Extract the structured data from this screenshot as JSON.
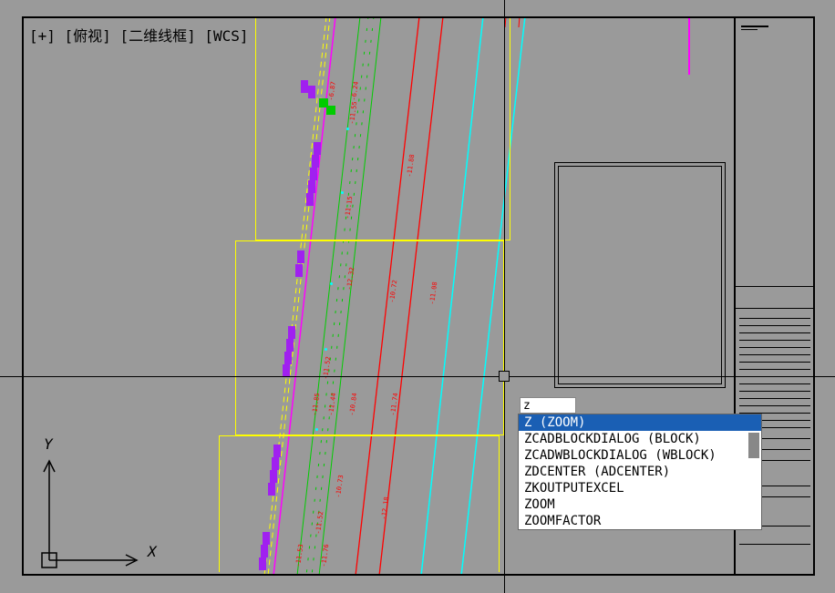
{
  "view_controls": {
    "toggle": "[+]",
    "view": "[俯视]",
    "style": "[二维线框]",
    "cs": "[WCS]"
  },
  "ucs": {
    "x_label": "X",
    "y_label": "Y"
  },
  "command": {
    "input_value": "z",
    "suggestions": [
      {
        "label": "Z (ZOOM)",
        "selected": true
      },
      {
        "label": "ZCADBLOCKDIALOG (BLOCK)",
        "selected": false
      },
      {
        "label": "ZCADWBLOCKDIALOG (WBLOCK)",
        "selected": false
      },
      {
        "label": "ZDCENTER (ADCENTER)",
        "selected": false
      },
      {
        "label": "ZKOUTPUTEXCEL",
        "selected": false
      },
      {
        "label": "ZOOM",
        "selected": false
      },
      {
        "label": "ZOOMFACTOR",
        "selected": false
      }
    ]
  },
  "annotations": {
    "d0": "-6.87",
    "d1": "-6.24",
    "d2": "-11.55",
    "d3": "-11.15",
    "d4": "-11.88",
    "d5": "-11.08",
    "d6": "-11.52",
    "d7": "-12.32",
    "d8": "-10.72",
    "d9": "-11.44",
    "d10": "-11.85",
    "d11": "-10.84",
    "d12": "-10.73",
    "d13": "-11.52",
    "d14": "-12.18",
    "d15": "-11.76",
    "d16": "-11.53",
    "d17": "-11.74"
  },
  "colors": {
    "yellow": "#ffff00",
    "red": "#ff0000",
    "green": "#00ff00",
    "cyan": "#00ffff",
    "magenta": "#ff00ff",
    "purple": "#a020f0"
  }
}
